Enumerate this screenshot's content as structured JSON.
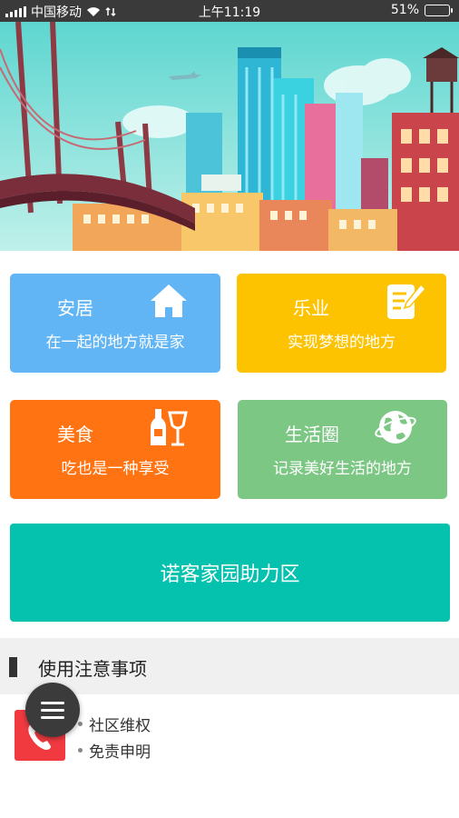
{
  "status_bar": {
    "carrier": "中国移动",
    "time": "上午11:19",
    "battery_percent": "51%",
    "battery_level": 0.51
  },
  "tiles": [
    {
      "title": "安居",
      "subtitle": "在一起的地方就是家",
      "color": "#62b5f5",
      "icon": "house-icon"
    },
    {
      "title": "乐业",
      "subtitle": "实现梦想的地方",
      "color": "#fdc300",
      "icon": "notepad-pen-icon"
    },
    {
      "title": "美食",
      "subtitle": "吃也是一种享受",
      "color": "#ff7313",
      "icon": "wine-bottle-glass-icon"
    },
    {
      "title": "生活圈",
      "subtitle": "记录美好生活的地方",
      "color": "#7dc785",
      "icon": "globe-icon"
    }
  ],
  "help_zone_label": "诺客家园助力区",
  "notice": {
    "heading": "使用注意事项",
    "links": [
      "社区维权",
      "免责申明"
    ]
  }
}
